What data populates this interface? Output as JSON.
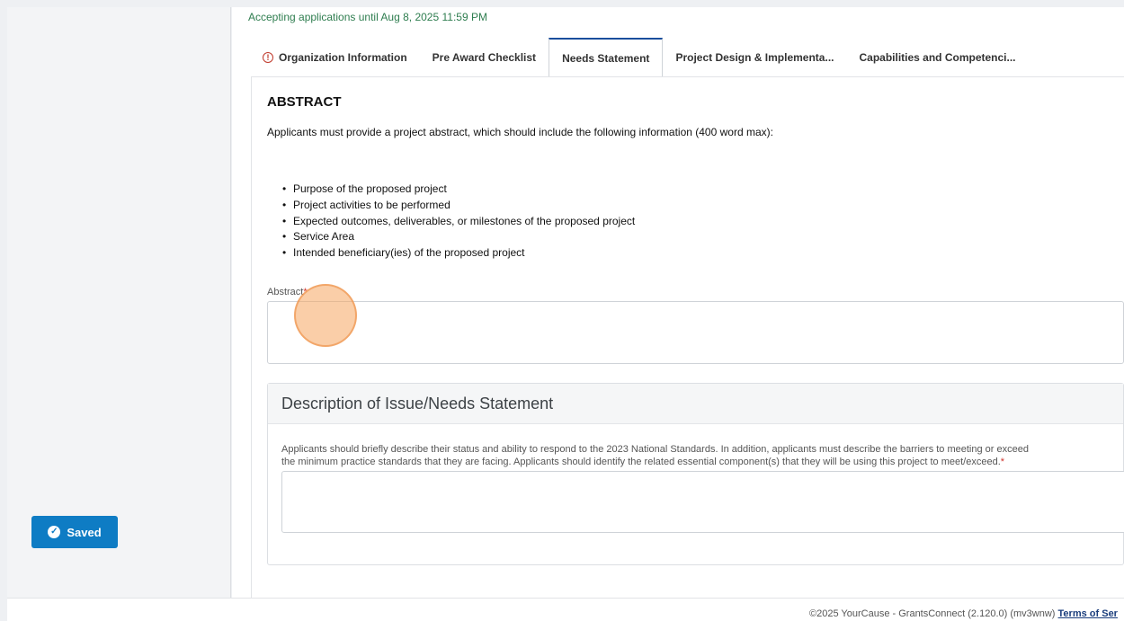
{
  "deadline": "Accepting applications until Aug 8, 2025 11:59 PM",
  "tabs": [
    {
      "label": "Organization Information",
      "icon": "warning-circle-icon"
    },
    {
      "label": "Pre Award Checklist"
    },
    {
      "label": "Needs Statement",
      "active": true
    },
    {
      "label": "Project Design & Implementa..."
    },
    {
      "label": "Capabilities and Competenci..."
    }
  ],
  "abstract": {
    "heading": "ABSTRACT",
    "instructions": "Applicants must provide a project abstract, which should include the following information (400 word max):",
    "bullets": [
      "Purpose of the proposed project",
      "Project activities to be performed",
      "Expected outcomes, deliverables, or milestones of the proposed project",
      "Service Area",
      "Intended beneficiary(ies) of the proposed project"
    ],
    "field_label": "Abstract",
    "required_mark": "*",
    "value": ""
  },
  "needs": {
    "title": "Description of Issue/Needs Statement",
    "description_line1": "Applicants should briefly describe their status and ability to respond to the 2023 National Standards. In addition, applicants must describe the barriers to meeting or exceed",
    "description_line2": "the minimum practice standards that they are facing. Applicants should identify the related essential component(s) that they will be using this project to meet/exceed.",
    "required_mark": "*",
    "value": ""
  },
  "saved_button": {
    "label": "Saved",
    "icon": "check-circle-icon"
  },
  "footer": {
    "text": "©2025 YourCause - GrantsConnect (2.120.0) (mv3wnw)",
    "link": "Terms of Ser"
  },
  "colors": {
    "accent": "#0e7cc4",
    "deadline": "#2e7d4f",
    "required": "#d0342c",
    "active_tab_border": "#1a4e9c"
  }
}
